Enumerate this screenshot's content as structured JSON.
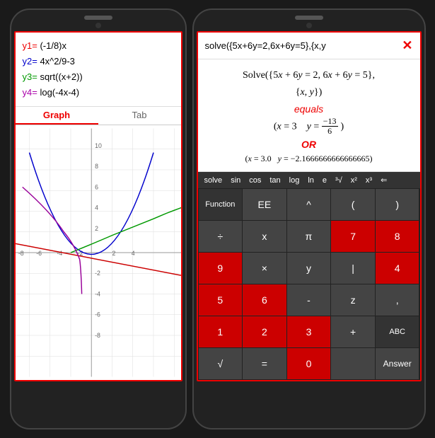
{
  "left_phone": {
    "functions": [
      {
        "label": "y1=",
        "expr": " (-1/8)x",
        "color_class": "y1"
      },
      {
        "label": "y2=",
        "expr": " 4x^2/9-3",
        "color_class": "y2"
      },
      {
        "label": "y3=",
        "expr": " sqrt((x+2))",
        "color_class": "y3"
      },
      {
        "label": "y4=",
        "expr": " log(-4x-4)",
        "color_class": "y4"
      }
    ],
    "tabs": [
      {
        "label": "Graph",
        "active": true
      },
      {
        "label": "Tab",
        "active": false
      }
    ]
  },
  "right_phone": {
    "input": "solve({5x+6y=2,6x+6y=5},{x,y",
    "close_label": "✕",
    "result": {
      "line1": "Solve({5x + 6y = 2, 6x + 6y = 5},",
      "line2": "{x, y})",
      "equals_label": "equals",
      "line3a": "x = 3",
      "line3b": "y = −13/6",
      "or_label": "OR",
      "line4": "(x = 3.0   y = −2.1666666666666665)"
    },
    "toolbar": [
      "solve",
      "sin",
      "cos",
      "tan",
      "log",
      "ln",
      "e",
      "³√",
      "x²",
      "x³",
      "⇐"
    ],
    "buttons": [
      {
        "label": "Function",
        "type": "btn-special"
      },
      {
        "label": "EE",
        "type": "btn-dark"
      },
      {
        "label": "^",
        "type": "btn-dark"
      },
      {
        "label": "(",
        "type": "btn-dark"
      },
      {
        "label": ")",
        "type": "btn-dark"
      },
      {
        "label": "÷",
        "type": "btn-dark"
      },
      {
        "label": "x",
        "type": "btn-dark"
      },
      {
        "label": "π",
        "type": "btn-dark"
      },
      {
        "label": "7",
        "type": "btn-red"
      },
      {
        "label": "8",
        "type": "btn-red"
      },
      {
        "label": "9",
        "type": "btn-red"
      },
      {
        "label": "×",
        "type": "btn-dark"
      },
      {
        "label": "y",
        "type": "btn-dark"
      },
      {
        "label": "|",
        "type": "btn-dark"
      },
      {
        "label": "4",
        "type": "btn-red"
      },
      {
        "label": "5",
        "type": "btn-red"
      },
      {
        "label": "6",
        "type": "btn-red"
      },
      {
        "label": "-",
        "type": "btn-dark"
      },
      {
        "label": "z",
        "type": "btn-dark"
      },
      {
        "label": ",",
        "type": "btn-dark"
      },
      {
        "label": "1",
        "type": "btn-red"
      },
      {
        "label": "2",
        "type": "btn-red"
      },
      {
        "label": "3",
        "type": "btn-red"
      },
      {
        "label": "+",
        "type": "btn-dark"
      },
      {
        "label": "ABC",
        "type": "btn-special"
      },
      {
        "label": "√",
        "type": "btn-dark"
      },
      {
        "label": "=",
        "type": "btn-dark"
      },
      {
        "label": "0",
        "type": "btn-red"
      },
      {
        "label": "",
        "type": "btn-dark"
      },
      {
        "label": "Answer",
        "type": "btn-dark"
      }
    ]
  }
}
